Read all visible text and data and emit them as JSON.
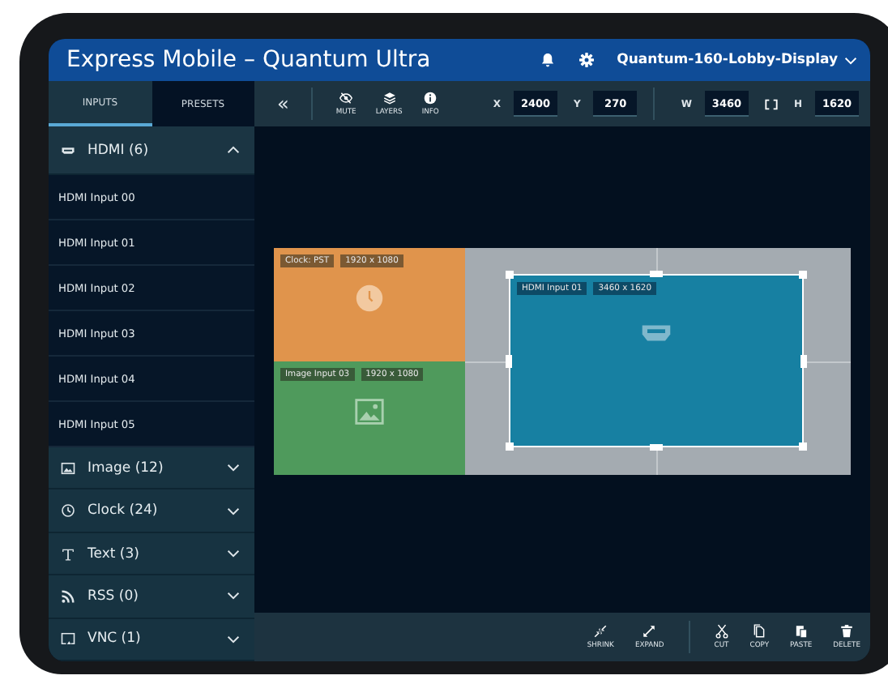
{
  "header": {
    "title": "Express Mobile – Quantum Ultra",
    "device": "Quantum-160-Lobby-Display"
  },
  "sidebar": {
    "tabs": [
      {
        "label": "INPUTS",
        "selected": true
      },
      {
        "label": "PRESETS",
        "selected": false
      }
    ],
    "categories": [
      {
        "kind": "hdmi",
        "label": "HDMI (6)",
        "expanded": true,
        "items": [
          "HDMI Input 00",
          "HDMI Input 01",
          "HDMI Input 02",
          "HDMI Input 03",
          "HDMI Input 04",
          "HDMI Input 05"
        ]
      },
      {
        "kind": "image",
        "label": "Image (12)",
        "expanded": false
      },
      {
        "kind": "clock",
        "label": "Clock (24)",
        "expanded": false
      },
      {
        "kind": "text",
        "label": "Text (3)",
        "expanded": false
      },
      {
        "kind": "rss",
        "label": "RSS (0)",
        "expanded": false
      },
      {
        "kind": "vnc",
        "label": "VNC (1)",
        "expanded": false
      }
    ]
  },
  "toolbar": {
    "collapse": "«",
    "view_tools": [
      {
        "kind": "mute",
        "label": "MUTE"
      },
      {
        "kind": "layers",
        "label": "LAYERS"
      },
      {
        "kind": "info",
        "label": "INFO"
      }
    ],
    "position": [
      {
        "label": "X",
        "value": "2400"
      },
      {
        "label": "Y",
        "value": "270"
      }
    ],
    "size": [
      {
        "label": "W",
        "value": "3460"
      },
      {
        "label": "H",
        "value": "1620"
      }
    ]
  },
  "canvas": {
    "windows": [
      {
        "kind": "clock",
        "name": "Clock: PST",
        "size": "1920 x 1080",
        "color": "#e0944c"
      },
      {
        "kind": "image",
        "name": "Image Input 03",
        "size": "1920 x 1080",
        "color": "#4f9a5c"
      }
    ],
    "selected_window": {
      "kind": "hdmi",
      "name": "HDMI Input 01",
      "size": "3460 x 1620",
      "color": "#1780a2"
    }
  },
  "bottom_bar": {
    "resize_tools": [
      {
        "kind": "shrink",
        "label": "SHRINK"
      },
      {
        "kind": "expand",
        "label": "EXPAND"
      }
    ],
    "edit_tools": [
      {
        "kind": "cut",
        "label": "CUT"
      },
      {
        "kind": "copy",
        "label": "COPY"
      },
      {
        "kind": "paste",
        "label": "PASTE"
      },
      {
        "kind": "delete",
        "label": "DELETE"
      }
    ]
  }
}
